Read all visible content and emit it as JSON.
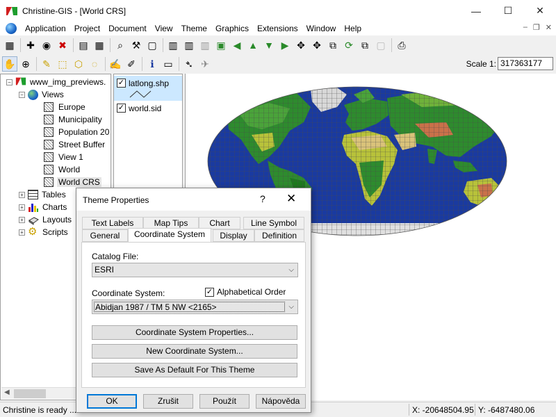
{
  "window": {
    "title": "Christine-GIS - [World CRS]",
    "controls": {
      "minimize": "—",
      "maximize": "☐",
      "close": "✕"
    }
  },
  "menu": {
    "items": [
      "Application",
      "Project",
      "Document",
      "View",
      "Theme",
      "Graphics",
      "Extensions",
      "Window",
      "Help"
    ],
    "mdi_controls": {
      "minimize": "–",
      "restore": "❐",
      "close": "✕"
    }
  },
  "toolbar": {
    "scale_label": "Scale 1:",
    "scale_value": "317363177"
  },
  "tree": {
    "root": "www_img_previews.",
    "views_label": "Views",
    "views": [
      "Europe",
      "Municipality",
      "Population 20",
      "Street Buffer",
      "View 1",
      "World",
      "World CRS"
    ],
    "selected_view": "World CRS",
    "folders": [
      "Tables",
      "Charts",
      "Layouts",
      "Scripts"
    ]
  },
  "legend": {
    "themes": [
      {
        "name": "latlong.shp",
        "checked": true,
        "selected": true
      },
      {
        "name": "world.sid",
        "checked": true,
        "selected": false
      }
    ]
  },
  "status": {
    "message": "Christine is ready ...",
    "x": "X: -20648504.95",
    "y": "Y: -6487480.06"
  },
  "dialog": {
    "title": "Theme Properties",
    "help": "?",
    "close": "✕",
    "tabs_row1": [
      "Text Labels",
      "Map Tips",
      "Chart",
      "Line Symbol"
    ],
    "tabs_row2": [
      "General",
      "Coordinate System",
      "Display",
      "Definition"
    ],
    "active_tab": "Coordinate System",
    "catalog_file_label": "Catalog File:",
    "catalog_file_value": "ESRI",
    "coord_system_label": "Coordinate System:",
    "alphabetical_label": "Alphabetical Order",
    "alphabetical_checked": true,
    "coord_system_value": "Abidjan 1987 / TM 5 NW <2165>",
    "buttons": {
      "properties": "Coordinate System Properties...",
      "new_system": "New Coordinate System...",
      "save_default": "Save As Default For This Theme",
      "ok": "OK",
      "cancel": "Zrušit",
      "apply": "Použít",
      "help": "Nápověda"
    }
  },
  "colors": {
    "ocean": "#1a3aa0",
    "land_low": "#2e8b2e",
    "land_mid": "#b8c23a",
    "land_high": "#c9714a",
    "graticule": "#555555",
    "selection": "#cce8ff"
  }
}
